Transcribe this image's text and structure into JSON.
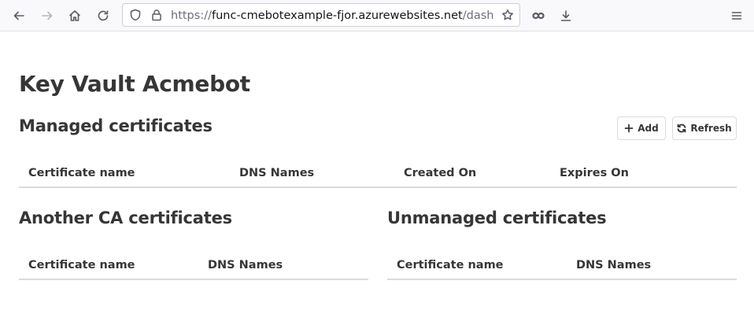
{
  "browser": {
    "url_scheme": "https://",
    "url_host": "func-cmebotexample-fjor.azurewebsites.net",
    "url_path": "/dashboard"
  },
  "page": {
    "title": "Key Vault Acmebot"
  },
  "managed": {
    "title": "Managed certificates",
    "add_label": "Add",
    "refresh_label": "Refresh",
    "columns": [
      "Certificate name",
      "DNS Names",
      "Created On",
      "Expires On"
    ]
  },
  "another_ca": {
    "title": "Another CA certificates",
    "columns": [
      "Certificate name",
      "DNS Names"
    ]
  },
  "unmanaged": {
    "title": "Unmanaged certificates",
    "columns": [
      "Certificate name",
      "DNS Names"
    ]
  }
}
